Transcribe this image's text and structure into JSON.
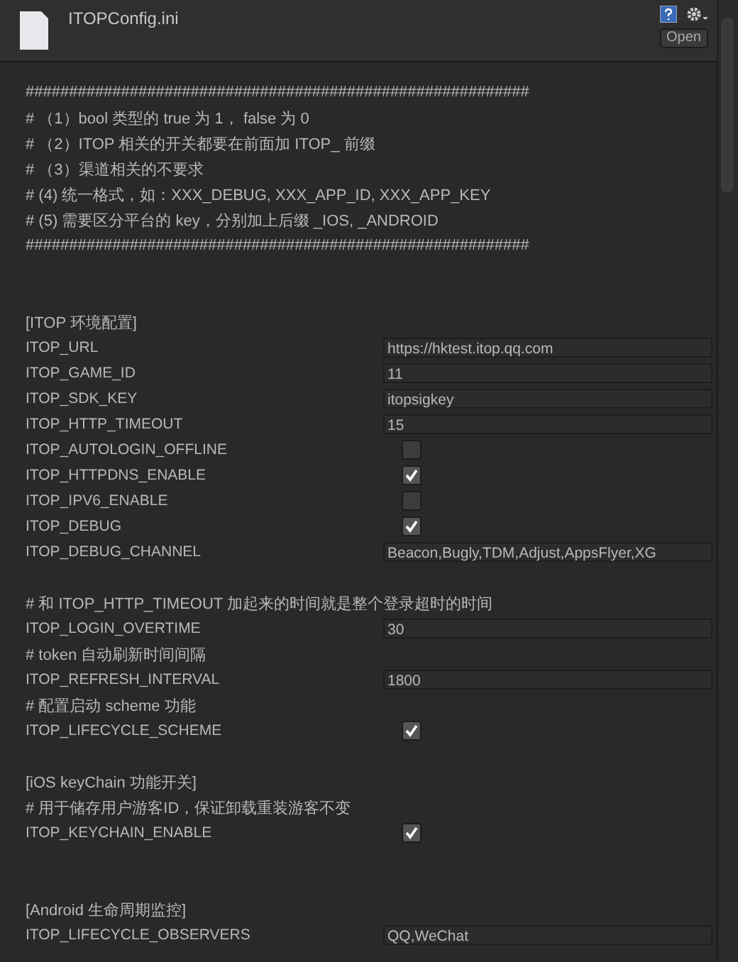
{
  "header": {
    "title": "ITOPConfig.ini",
    "open_button": "Open"
  },
  "lines": [
    {
      "kind": "comment",
      "text": "##########################################################"
    },
    {
      "kind": "comment",
      "text": "# （1）bool 类型的 true 为 1， false 为 0"
    },
    {
      "kind": "comment",
      "text": "# （2）ITOP 相关的开关都要在前面加 ITOP_ 前缀"
    },
    {
      "kind": "comment",
      "text": "# （3）渠道相关的不要求"
    },
    {
      "kind": "comment",
      "text": "# (4) 统一格式，如：XXX_DEBUG, XXX_APP_ID, XXX_APP_KEY"
    },
    {
      "kind": "comment",
      "text": "# (5) 需要区分平台的 key，分别加上后缀 _IOS, _ANDROID"
    },
    {
      "kind": "comment",
      "text": "##########################################################"
    },
    {
      "kind": "blank"
    },
    {
      "kind": "blank"
    },
    {
      "kind": "section",
      "text": "[ITOP 环境配置]"
    },
    {
      "kind": "field",
      "label": "ITOP_URL",
      "value": "https://hktest.itop.qq.com"
    },
    {
      "kind": "field",
      "label": "ITOP_GAME_ID",
      "value": "11"
    },
    {
      "kind": "field",
      "label": "ITOP_SDK_KEY",
      "value": "itopsigkey"
    },
    {
      "kind": "field",
      "label": "ITOP_HTTP_TIMEOUT",
      "value": "15"
    },
    {
      "kind": "toggle",
      "label": "ITOP_AUTOLOGIN_OFFLINE",
      "checked": false
    },
    {
      "kind": "toggle",
      "label": "ITOP_HTTPDNS_ENABLE",
      "checked": true
    },
    {
      "kind": "toggle",
      "label": "ITOP_IPV6_ENABLE",
      "checked": false
    },
    {
      "kind": "toggle",
      "label": "ITOP_DEBUG",
      "checked": true
    },
    {
      "kind": "field",
      "label": "ITOP_DEBUG_CHANNEL",
      "value": "Beacon,Bugly,TDM,Adjust,AppsFlyer,XG"
    },
    {
      "kind": "blank"
    },
    {
      "kind": "comment",
      "text": "# 和 ITOP_HTTP_TIMEOUT 加起来的时间就是整个登录超时的时间"
    },
    {
      "kind": "field",
      "label": "ITOP_LOGIN_OVERTIME",
      "value": "30"
    },
    {
      "kind": "comment",
      "text": "# token 自动刷新时间间隔"
    },
    {
      "kind": "field",
      "label": "ITOP_REFRESH_INTERVAL",
      "value": "1800"
    },
    {
      "kind": "comment",
      "text": "# 配置启动 scheme 功能"
    },
    {
      "kind": "toggle",
      "label": "ITOP_LIFECYCLE_SCHEME",
      "checked": true
    },
    {
      "kind": "blank"
    },
    {
      "kind": "section",
      "text": "[iOS keyChain 功能开关]"
    },
    {
      "kind": "comment",
      "text": "# 用于储存用户游客ID，保证卸载重装游客不变"
    },
    {
      "kind": "toggle",
      "label": "ITOP_KEYCHAIN_ENABLE",
      "checked": true
    },
    {
      "kind": "blank"
    },
    {
      "kind": "blank"
    },
    {
      "kind": "section",
      "text": "[Android 生命周期监控]"
    },
    {
      "kind": "field",
      "label": "ITOP_LIFECYCLE_OBSERVERS",
      "value": "QQ,WeChat"
    }
  ]
}
